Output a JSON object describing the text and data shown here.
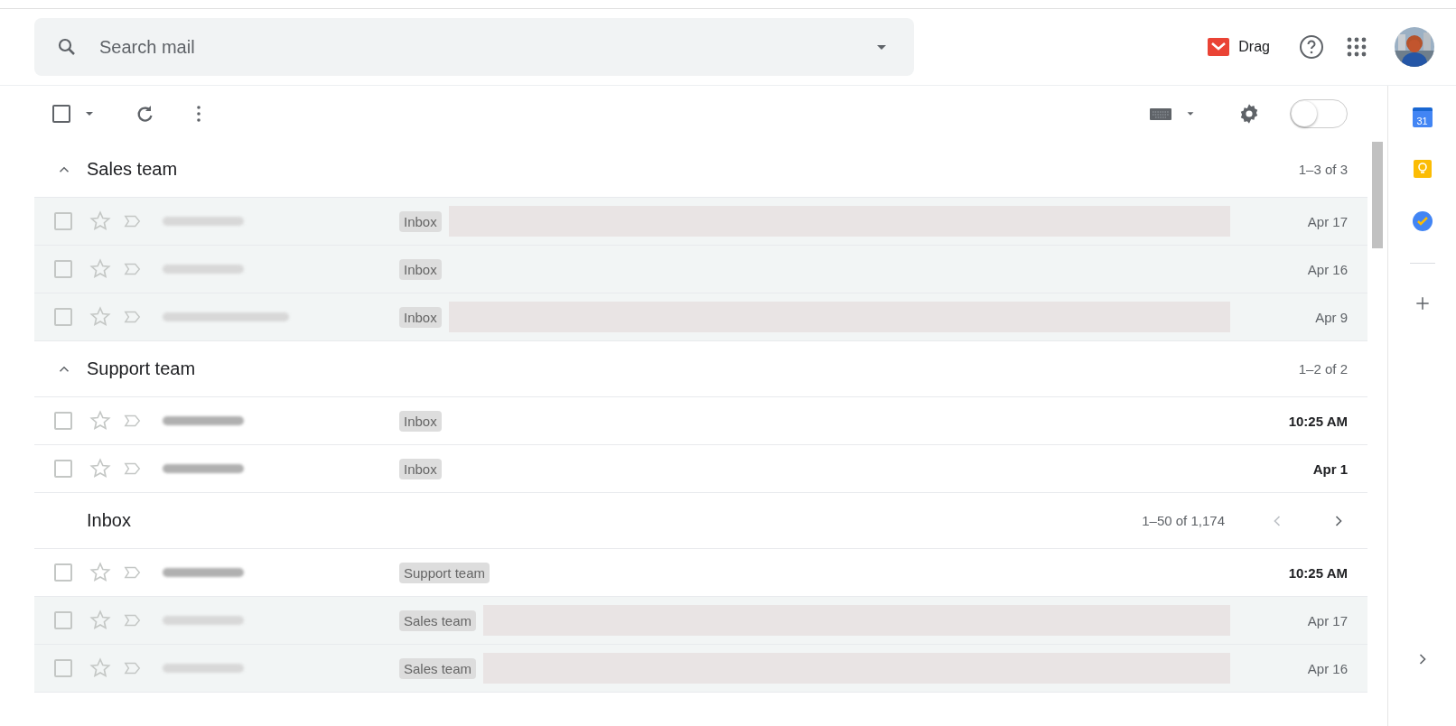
{
  "search": {
    "placeholder": "Search mail"
  },
  "header": {
    "drag_label": "Drag"
  },
  "toolbar": {
    "select_all_checked": false,
    "toggle_on": false
  },
  "sections": [
    {
      "title": "Sales team",
      "count": "1–3 of 3",
      "expanded": true,
      "rows": [
        {
          "sender_wide": false,
          "label": "Inbox",
          "redacted": true,
          "date": "Apr 17",
          "unread": false,
          "starred": false,
          "checked": false
        },
        {
          "sender_wide": false,
          "label": "Inbox",
          "redacted": false,
          "date": "Apr 16",
          "unread": false,
          "starred": false,
          "checked": false
        },
        {
          "sender_wide": true,
          "label": "Inbox",
          "redacted": true,
          "date": "Apr 9",
          "unread": false,
          "starred": false,
          "checked": false
        }
      ]
    },
    {
      "title": "Support team",
      "count": "1–2 of 2",
      "expanded": true,
      "rows": [
        {
          "sender_wide": false,
          "label": "Inbox",
          "redacted": false,
          "date": "10:25 AM",
          "unread": true,
          "starred": false,
          "checked": false
        },
        {
          "sender_wide": false,
          "label": "Inbox",
          "redacted": false,
          "date": "Apr 1",
          "unread": true,
          "starred": false,
          "checked": false
        }
      ]
    },
    {
      "title": "Inbox",
      "count": "1–50 of 1,174",
      "pager": {
        "previous_disabled": true,
        "next_disabled": false
      },
      "rows": [
        {
          "sender_wide": false,
          "label": "Support team",
          "redacted": false,
          "date": "10:25 AM",
          "unread": true,
          "starred": false,
          "checked": false
        },
        {
          "sender_wide": false,
          "label": "Sales team",
          "redacted": true,
          "date": "Apr 17",
          "unread": false,
          "starred": false,
          "checked": false
        },
        {
          "sender_wide": false,
          "label": "Sales team",
          "redacted": true,
          "date": "Apr 16",
          "unread": false,
          "starred": false,
          "checked": false
        }
      ]
    }
  ],
  "side_panel": {
    "calendar_day": "31"
  }
}
